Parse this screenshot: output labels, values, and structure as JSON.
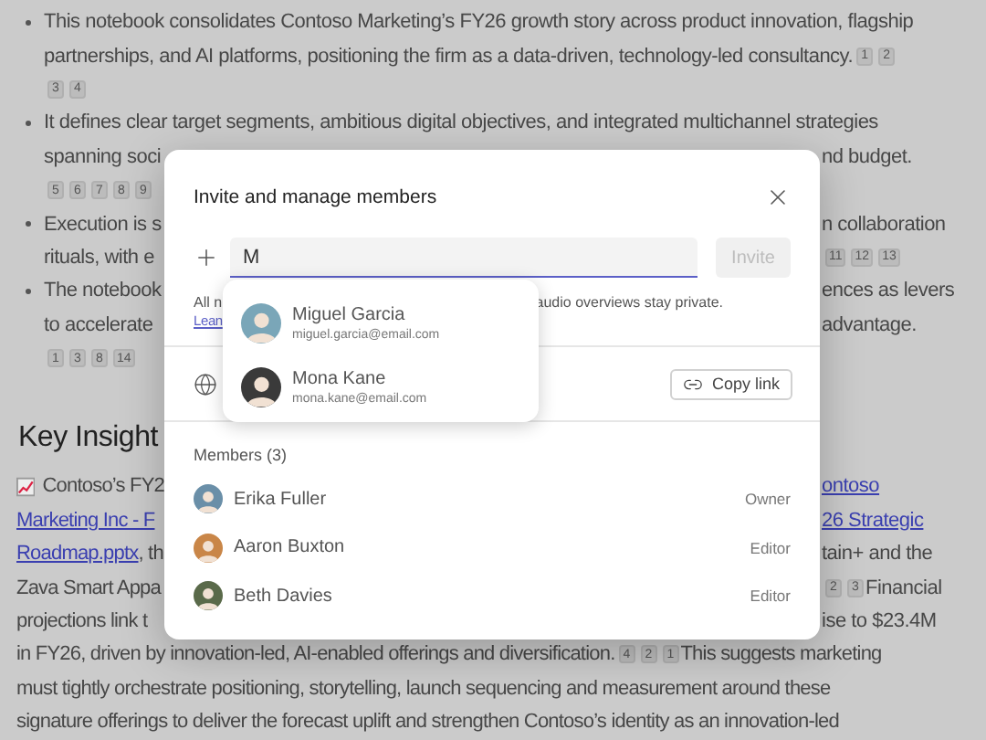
{
  "document": {
    "lines": [
      {
        "kind": "bullet",
        "left": [
          {
            "kind": "text",
            "text": "This notebook consolidates Contoso Marketing’s FY26 growth story across product innovation, flagship"
          }
        ]
      },
      {
        "kind": "cont",
        "left": [
          {
            "kind": "text",
            "text": "partnerships, and AI platforms, positioning the firm as a data-driven, technology-led consultancy."
          },
          {
            "kind": "ref",
            "text": "1"
          },
          {
            "kind": "ref",
            "text": "2"
          }
        ]
      },
      {
        "kind": "cont",
        "left": [
          {
            "kind": "ref",
            "text": "3"
          },
          {
            "kind": "ref",
            "text": "4"
          }
        ]
      },
      {
        "kind": "bullet",
        "left": [
          {
            "kind": "text",
            "text": "It defines clear target segments, ambitious digital objectives, and integrated multichannel strategies"
          }
        ]
      },
      {
        "kind": "cont",
        "left": [
          {
            "kind": "text",
            "text": "spanning soci"
          }
        ],
        "right": [
          {
            "kind": "text",
            "text": "nd budget."
          }
        ]
      },
      {
        "kind": "cont",
        "left": [
          {
            "kind": "ref",
            "text": "5"
          },
          {
            "kind": "ref",
            "text": "6"
          },
          {
            "kind": "ref",
            "text": "7"
          },
          {
            "kind": "ref",
            "text": "8"
          },
          {
            "kind": "ref",
            "text": "9"
          }
        ]
      },
      {
        "kind": "bullet",
        "left": [
          {
            "kind": "text",
            "text": "Execution is s"
          }
        ],
        "right": [
          {
            "kind": "text",
            "text": "n collaboration"
          }
        ]
      },
      {
        "kind": "cont",
        "left": [
          {
            "kind": "text",
            "text": "rituals, with e"
          }
        ],
        "right": [
          {
            "kind": "ref",
            "text": "11"
          },
          {
            "kind": "ref",
            "text": "12"
          },
          {
            "kind": "ref",
            "text": "13"
          }
        ]
      },
      {
        "kind": "bullet",
        "left": [
          {
            "kind": "text",
            "text": "The notebook"
          }
        ],
        "right": [
          {
            "kind": "text",
            "text": "ences as levers"
          }
        ]
      },
      {
        "kind": "cont",
        "left": [
          {
            "kind": "text",
            "text": "to accelerate"
          }
        ],
        "right": [
          {
            "kind": "text",
            "text": "advantage."
          }
        ]
      },
      {
        "kind": "cont",
        "left": [
          {
            "kind": "ref",
            "text": "1"
          },
          {
            "kind": "ref",
            "text": "3"
          },
          {
            "kind": "ref",
            "text": "8"
          },
          {
            "kind": "ref",
            "text": "14"
          }
        ]
      },
      {
        "kind": "heading",
        "left": [
          {
            "kind": "text",
            "text": "Key Insight"
          }
        ]
      },
      {
        "kind": "para",
        "left": [
          {
            "kind": "chart-icon"
          },
          {
            "kind": "text",
            "text": "Contoso’s FY2"
          }
        ],
        "right": [
          {
            "kind": "link",
            "text": "ontoso"
          }
        ]
      },
      {
        "kind": "para",
        "left": [
          {
            "kind": "link",
            "text": "Marketing Inc - F"
          }
        ],
        "right": [
          {
            "kind": "link",
            "text": "26 Strategic"
          }
        ]
      },
      {
        "kind": "para",
        "left": [
          {
            "kind": "link",
            "text": "Roadmap.pptx"
          },
          {
            "kind": "text",
            "text": ", th"
          }
        ],
        "right": [
          {
            "kind": "text",
            "text": "tain+ and the"
          }
        ]
      },
      {
        "kind": "para",
        "left": [
          {
            "kind": "text",
            "text": "Zava Smart Appa"
          }
        ],
        "right": [
          {
            "kind": "ref",
            "text": "2"
          },
          {
            "kind": "ref",
            "text": "3"
          },
          {
            "kind": "text",
            "text": "Financial"
          }
        ]
      },
      {
        "kind": "para",
        "left": [
          {
            "kind": "text",
            "text": "projections link t"
          }
        ],
        "right": [
          {
            "kind": "text",
            "text": "ise to $23.4M"
          }
        ]
      },
      {
        "kind": "para",
        "left": [
          {
            "kind": "text",
            "text": "in FY26, driven by innovation-led, AI-enabled offerings and diversification."
          },
          {
            "kind": "ref",
            "text": "4"
          },
          {
            "kind": "ref",
            "text": "2"
          },
          {
            "kind": "ref",
            "text": "1"
          },
          {
            "kind": "text",
            "text": "This suggests marketing"
          }
        ]
      },
      {
        "kind": "para",
        "left": [
          {
            "kind": "text",
            "text": "must tightly orchestrate positioning, storytelling, launch sequencing and measurement around these"
          }
        ]
      },
      {
        "kind": "para",
        "left": [
          {
            "kind": "text",
            "text": "signature offerings to deliver the forecast uplift and strengthen Contoso’s identity as an innovation-led"
          }
        ]
      }
    ]
  },
  "dialog": {
    "title": "Invite and manage members",
    "invite": {
      "value": "M",
      "button": {
        "label": "Invite",
        "disabled": true
      }
    },
    "suggestions": [
      {
        "name": "Miguel Garcia",
        "email": "miguel.garcia@email.com"
      },
      {
        "name": "Mona Kane",
        "email": "mona.kane@email.com"
      }
    ],
    "notice": {
      "left": "All n",
      "right": "audio overviews stay private.",
      "link": "Lean"
    },
    "share": {
      "button": "Copy link"
    },
    "members": {
      "heading": "Members (3)",
      "items": [
        {
          "name": "Erika Fuller",
          "role": "Owner"
        },
        {
          "name": "Aaron Buxton",
          "role": "Editor"
        },
        {
          "name": "Beth Davies",
          "role": "Editor"
        }
      ]
    }
  }
}
